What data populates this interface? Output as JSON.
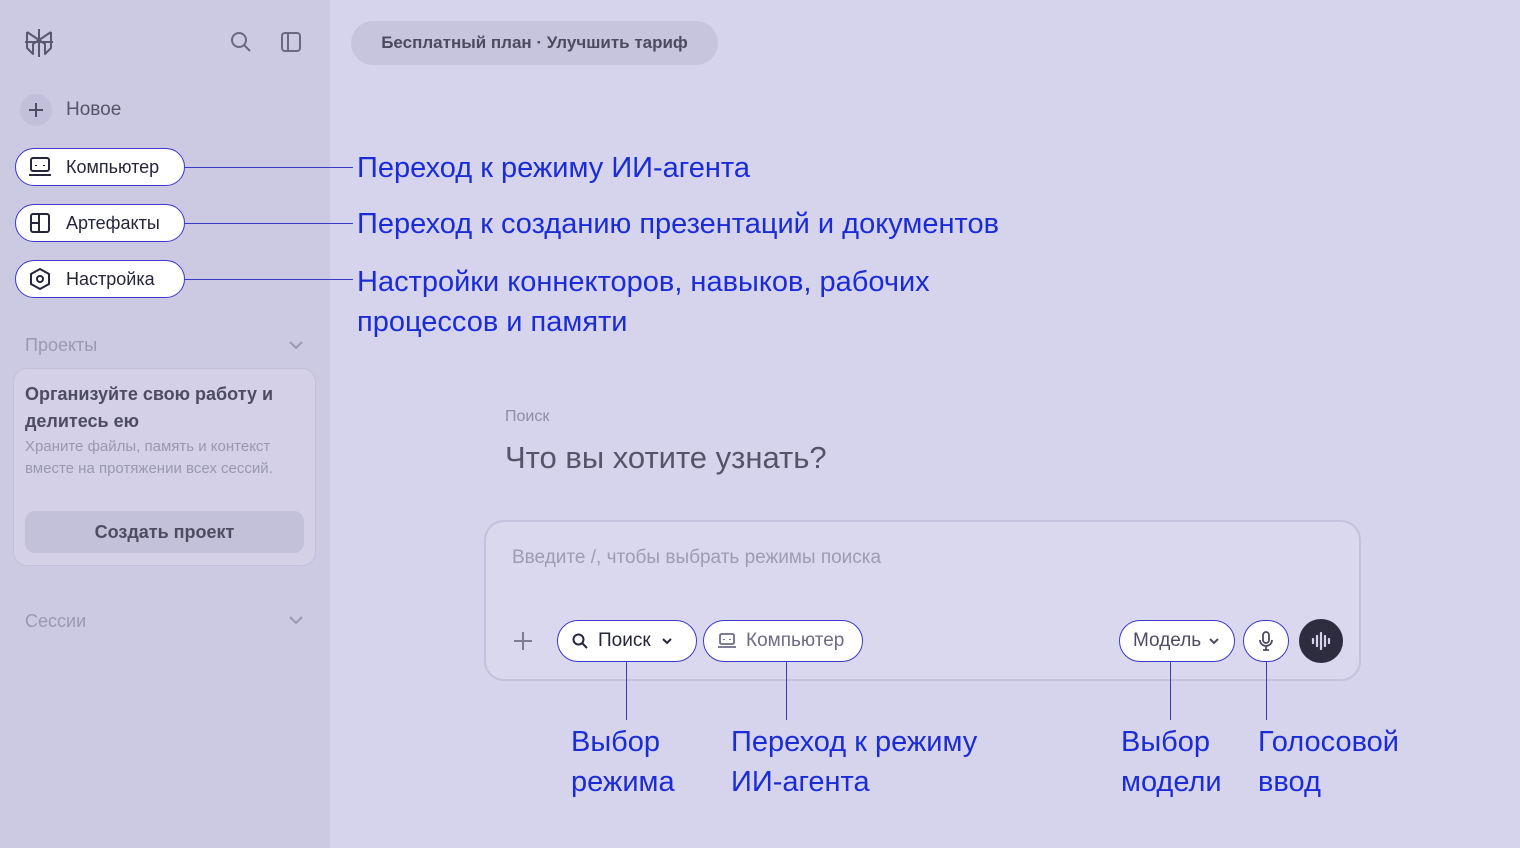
{
  "colors": {
    "background": "#d5d4ec",
    "sidebar": "#ccc9e3",
    "annotation": "#1b2cd6",
    "highlight_border": "#3a3ac9"
  },
  "sidebar": {
    "new_label": "Новое",
    "items": [
      {
        "label": "Компьютер",
        "icon": "computer-icon"
      },
      {
        "label": "Артефакты",
        "icon": "artifacts-icon"
      },
      {
        "label": "Настройка",
        "icon": "settings-icon"
      }
    ],
    "projects_title": "Проекты",
    "project_card": {
      "title": "Организуйте свою работу и делитесь ею",
      "description": "Храните файлы, память и контекст вместе на протяжении всех сессий.",
      "button": "Создать проект"
    },
    "sessions_title": "Сессии"
  },
  "header": {
    "plan": "Бесплатный план · Улучшить тариф"
  },
  "main": {
    "mode_label": "Поиск",
    "headline": "Что вы хотите узнать?",
    "input_placeholder": "Введите /, чтобы выбрать режимы поиска",
    "toolbar": {
      "mode_select": "Поиск",
      "computer": "Компьютер",
      "model_select": "Модель"
    }
  },
  "annotations": {
    "computer": "Переход к режиму ИИ-агента",
    "artifacts": "Переход к созданию презентаций и документов",
    "settings_line1": "Настройки коннекторов, навыков, рабочих",
    "settings_line2": "процессов и памяти",
    "mode_line1": "Выбор",
    "mode_line2": "режима",
    "agent_line1": "Переход к режиму",
    "agent_line2": "ИИ-агента",
    "model_line1": "Выбор",
    "model_line2": "модели",
    "voice_line1": "Голосовой",
    "voice_line2": "ввод"
  }
}
